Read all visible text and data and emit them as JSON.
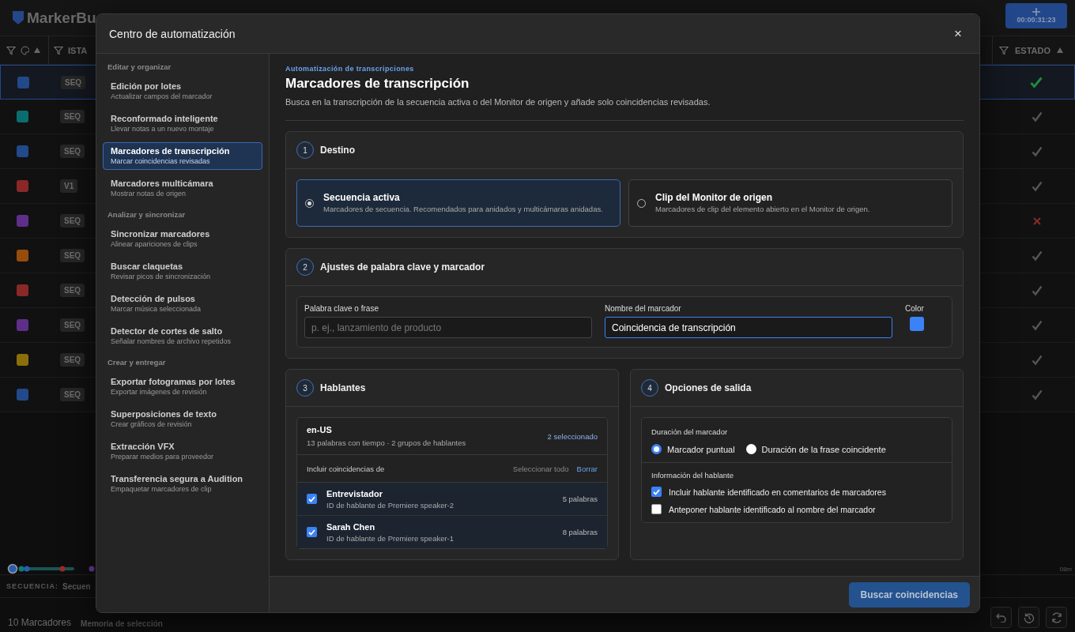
{
  "app": {
    "logo": "MarkerBu",
    "timecode": "00:00:31:23",
    "columns": [
      "ISTA",
      "ESTADO"
    ],
    "rows": [
      {
        "color": "#22498a",
        "badge": "SEQ",
        "kind": "approved",
        "selected": true
      },
      {
        "color": "#0b6e6e",
        "badge": "SEQ",
        "kind": "done",
        "selected": false
      },
      {
        "color": "#22498a",
        "badge": "SEQ",
        "kind": "done",
        "selected": false
      },
      {
        "color": "#8a2828",
        "badge": "V1",
        "kind": "done",
        "selected": false
      },
      {
        "color": "#5f2e8a",
        "badge": "SEQ",
        "kind": "rejected",
        "selected": false
      },
      {
        "color": "#964c0a",
        "badge": "SEQ",
        "kind": "done",
        "selected": false
      },
      {
        "color": "#8a2828",
        "badge": "SEQ",
        "kind": "done",
        "selected": false
      },
      {
        "color": "#5f2e8a",
        "badge": "SEQ",
        "kind": "done",
        "selected": false
      },
      {
        "color": "#8c6e0a",
        "badge": "SEQ",
        "kind": "done",
        "selected": false
      },
      {
        "color": "#22498a",
        "badge": "SEQ",
        "kind": "done",
        "selected": false
      }
    ],
    "timeline_end": "08m",
    "sequence_label": "SECUENCIA:",
    "sequence_name": "Secuen",
    "marker_count": "10 Marcadores",
    "selection_memory": "Memoria de selección"
  },
  "dialog": {
    "title": "Centro de automatización",
    "close": "×",
    "nav": [
      {
        "label": "Editar y organizar",
        "items": [
          {
            "title": "Edición por lotes",
            "subtitle": "Actualizar campos del marcador",
            "selected": false
          },
          {
            "title": "Reconformado inteligente",
            "subtitle": "Llevar notas a un nuevo montaje",
            "selected": false
          },
          {
            "title": "Marcadores de transcripción",
            "subtitle": "Marcar coincidencias revisadas",
            "selected": true
          },
          {
            "title": "Marcadores multicámara",
            "subtitle": "Mostrar notas de origen",
            "selected": false
          }
        ]
      },
      {
        "label": "Analizar y sincronizar",
        "items": [
          {
            "title": "Sincronizar marcadores",
            "subtitle": "Alinear apariciones de clips",
            "selected": false
          },
          {
            "title": "Buscar claquetas",
            "subtitle": "Revisar picos de sincronización",
            "selected": false
          },
          {
            "title": "Detección de pulsos",
            "subtitle": "Marcar música seleccionada",
            "selected": false
          },
          {
            "title": "Detector de cortes de salto",
            "subtitle": "Señalar nombres de archivo repetidos",
            "selected": false
          }
        ]
      },
      {
        "label": "Crear y entregar",
        "items": [
          {
            "title": "Exportar fotogramas por lotes",
            "subtitle": "Exportar imágenes de revisión",
            "selected": false
          },
          {
            "title": "Superposiciones de texto",
            "subtitle": "Crear gráficos de revisión",
            "selected": false
          },
          {
            "title": "Extracción VFX",
            "subtitle": "Preparar medios para proveedor",
            "selected": false
          },
          {
            "title": "Transferencia segura a Audition",
            "subtitle": "Empaquetar marcadores de clip",
            "selected": false
          }
        ]
      }
    ],
    "eyebrow": "Automatización de transcripciones",
    "heading": "Marcadores de transcripción",
    "description": "Busca en la transcripción de la secuencia activa o del Monitor de origen y añade solo coincidencias revisadas.",
    "destination": {
      "number": "1",
      "title": "Destino",
      "options": [
        {
          "title": "Secuencia activa",
          "description": "Marcadores de secuencia. Recomendados para anidados y multicámaras anidadas.",
          "selected": true
        },
        {
          "title": "Clip del Monitor de origen",
          "description": "Marcadores de clip del elemento abierto en el Monitor de origen.",
          "selected": false
        }
      ]
    },
    "settings": {
      "number": "2",
      "title": "Ajustes de palabra clave y marcador",
      "keyword": {
        "label": "Palabra clave o frase",
        "placeholder": "p. ej., lanzamiento de producto"
      },
      "marker_name": {
        "label": "Nombre del marcador",
        "value": "Coincidencia de transcripción"
      },
      "marker_color": {
        "label": "Color",
        "color": "#3b82f6"
      }
    },
    "speakers": {
      "number": "3",
      "title": "Hablantes",
      "language": "en-US",
      "summary": "13 palabras con tiempo · 2 grupos de hablantes",
      "selected_count": "2 seleccionado",
      "include_label": "Incluir coincidencias de",
      "select_all": "Seleccionar todo",
      "clear": "Borrar",
      "items": [
        {
          "name": "Entrevistador",
          "id": "ID de hablante de Premiere speaker-2",
          "words": "5 palabras",
          "checked": true
        },
        {
          "name": "Sarah Chen",
          "id": "ID de hablante de Premiere speaker-1",
          "words": "8 palabras",
          "checked": true
        }
      ]
    },
    "output": {
      "number": "4",
      "title": "Opciones de salida",
      "duration_label": "Duración del marcador",
      "duration_options": [
        {
          "label": "Marcador puntual",
          "selected": true
        },
        {
          "label": "Duración de la frase coincidente",
          "selected": false
        }
      ],
      "speaker_info_label": "Información del hablante",
      "speaker_options": [
        {
          "label": "Incluir hablante identificado en comentarios de marcadores",
          "checked": true
        },
        {
          "label": "Anteponer hablante identificado al nombre del marcador",
          "checked": false
        }
      ]
    },
    "submit": "Buscar coincidencias"
  }
}
